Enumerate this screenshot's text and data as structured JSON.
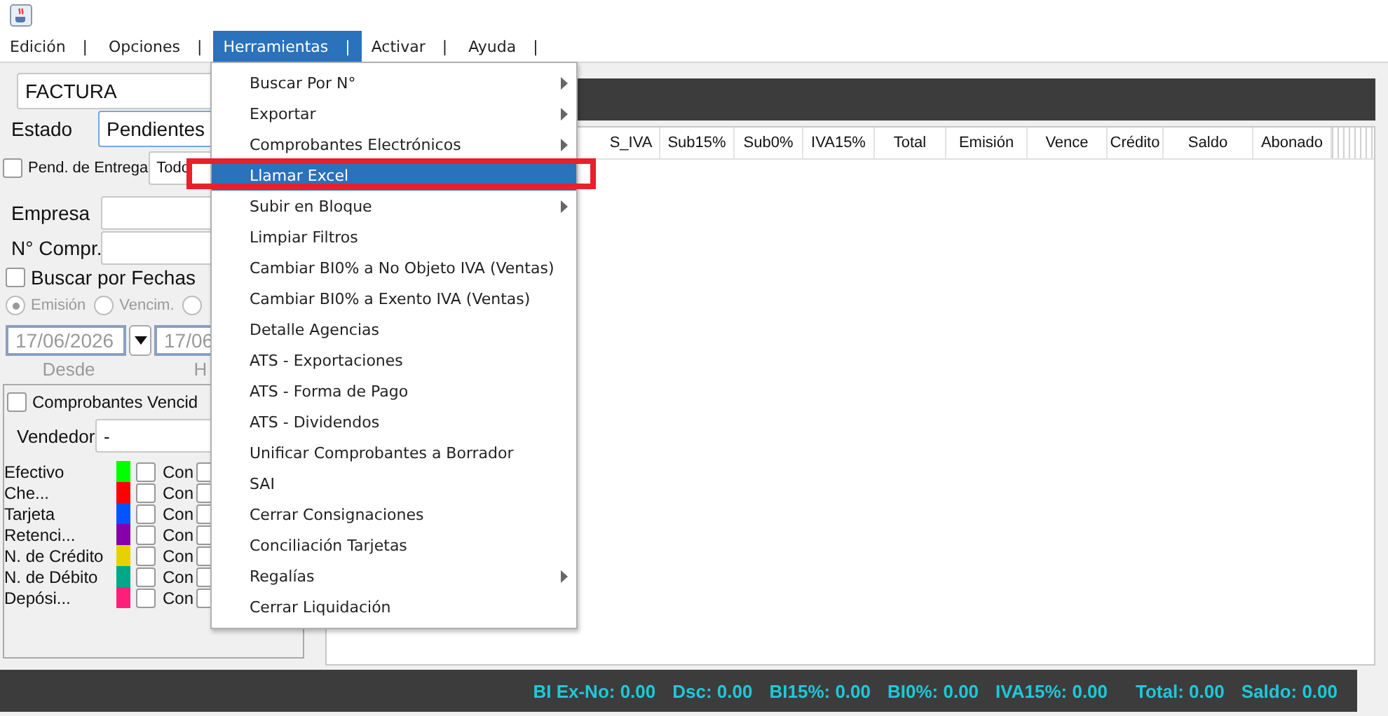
{
  "menubar": [
    {
      "label": "Edición",
      "selected": false,
      "separator": "|"
    },
    {
      "label": "Opciones",
      "selected": false,
      "separator": "|"
    },
    {
      "label": "Herramientas",
      "selected": true,
      "separator": "|"
    },
    {
      "label": "Activar",
      "selected": false,
      "separator": "|"
    },
    {
      "label": "Ayuda",
      "selected": false,
      "separator": "|"
    }
  ],
  "open_menu": {
    "items": [
      {
        "label": "Buscar Por N°",
        "selected": false,
        "submenu": true
      },
      {
        "label": "Exportar",
        "selected": false,
        "submenu": true
      },
      {
        "label": "Comprobantes Electrónicos",
        "selected": false,
        "submenu": true
      },
      {
        "label": "Llamar Excel",
        "selected": true,
        "submenu": false
      },
      {
        "label": "Subir en Bloque",
        "selected": false,
        "submenu": true
      },
      {
        "label": "Limpiar Filtros",
        "selected": false,
        "submenu": false
      },
      {
        "label": "Cambiar BI0% a No Objeto IVA (Ventas)",
        "selected": false,
        "submenu": false
      },
      {
        "label": "Cambiar BI0% a Exento IVA (Ventas)",
        "selected": false,
        "submenu": false
      },
      {
        "label": "Detalle Agencias",
        "selected": false,
        "submenu": false
      },
      {
        "label": "ATS - Exportaciones",
        "selected": false,
        "submenu": false
      },
      {
        "label": "ATS - Forma de Pago",
        "selected": false,
        "submenu": false
      },
      {
        "label": "ATS - Dividendos",
        "selected": false,
        "submenu": false
      },
      {
        "label": "Unificar Comprobantes a Borrador",
        "selected": false,
        "submenu": false
      },
      {
        "label": "SAI",
        "selected": false,
        "submenu": false
      },
      {
        "label": "Cerrar Consignaciones",
        "selected": false,
        "submenu": false
      },
      {
        "label": "Conciliación Tarjetas",
        "selected": false,
        "submenu": false
      },
      {
        "label": "Regalías",
        "selected": false,
        "submenu": true
      },
      {
        "label": "Cerrar Liquidación",
        "selected": false,
        "submenu": false
      }
    ]
  },
  "filters": {
    "document_type": "FACTURA",
    "estado": {
      "label": "Estado",
      "value": "Pendientes"
    },
    "pend_entrega": {
      "label": "Pend. de Entrega",
      "checked": false,
      "value": "Todo"
    },
    "empresa": {
      "label": "Empresa"
    },
    "numero": {
      "label": "N° Compr."
    },
    "buscar_fechas": {
      "label": "Buscar por Fechas",
      "checked": false
    },
    "dates_disabled": true,
    "date_type": [
      {
        "label": "Emisión",
        "selected": true
      },
      {
        "label": "Vencim.",
        "selected": false
      },
      {
        "selected": false
      }
    ],
    "from": {
      "value": "17/06/2026",
      "label": "Desde"
    },
    "to": {
      "value": "17/06",
      "label": "H"
    }
  },
  "expired_panel": {
    "vencidos": {
      "label": "Comprobantes Vencid",
      "checked": false
    },
    "vendedor": {
      "label": "Vendedor",
      "value": "-"
    },
    "payment_types": [
      {
        "name": "Efectivo",
        "color": "#00ff00",
        "checked": false,
        "mode": "Con",
        "second_checked": false
      },
      {
        "name": "Che...",
        "color": "#ff0000",
        "checked": false,
        "mode": "Con",
        "second_checked": false
      },
      {
        "name": "Tarjeta",
        "color": "#0055ff",
        "checked": false,
        "mode": "Con",
        "second_checked": false
      },
      {
        "name": "Retenci...",
        "color": "#8800aa",
        "checked": false,
        "mode": "Con",
        "second_checked": false
      },
      {
        "name": "N. de Crédito",
        "color": "#e6d200",
        "checked": false,
        "mode": "Con",
        "second_checked": false
      },
      {
        "name": "N. de Débito",
        "color": "#00a88a",
        "checked": false,
        "mode": "Con",
        "second_checked": false
      },
      {
        "name": "Depósi...",
        "color": "#ff1f7a",
        "checked": false,
        "mode": "Con",
        "second_checked": false
      }
    ]
  },
  "table": {
    "columns": [
      "S_IVA",
      "Sub15%",
      "Sub0%",
      "IVA15%",
      "Total",
      "Emisión",
      "Vence",
      "Crédito",
      "Saldo",
      "Abonado"
    ]
  },
  "status_bar": [
    "BI Ex-No: 0.00",
    "Dsc: 0.00",
    "BI15%: 0.00",
    "BI0%: 0.00",
    "IVA15%: 0.00",
    "Total: 0.00",
    "Saldo: 0.00"
  ]
}
